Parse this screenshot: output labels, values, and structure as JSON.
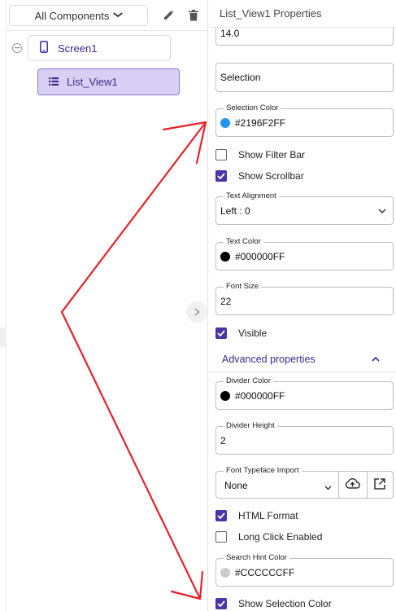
{
  "left_panel": {
    "component_filter": "All Components",
    "tree": {
      "screen": "Screen1",
      "list_view": "List_View1"
    }
  },
  "properties": {
    "title": "List_View1 Properties",
    "font_size_top_value": "14.0",
    "selection_value": "Selection",
    "selection_color": {
      "label": "Selection Color",
      "value": "#2196F2FF",
      "swatch": "#2196F2"
    },
    "show_filter_bar": {
      "label": "Show Filter Bar",
      "checked": false
    },
    "show_scrollbar": {
      "label": "Show Scrollbar",
      "checked": true
    },
    "text_alignment": {
      "label": "Text Alignment",
      "value": "Left : 0"
    },
    "text_color": {
      "label": "Text Color",
      "value": "#000000FF",
      "swatch": "#000000"
    },
    "font_size": {
      "label": "Font Size",
      "value": "22"
    },
    "visible": {
      "label": "Visible",
      "checked": true
    },
    "advanced_label": "Advanced properties",
    "divider_color": {
      "label": "Divider Color",
      "value": "#000000FF",
      "swatch": "#000000"
    },
    "divider_height": {
      "label": "Divider Height",
      "value": "2"
    },
    "font_typeface_import": {
      "label": "Font Typeface Import",
      "value": "None"
    },
    "html_format": {
      "label": "HTML Format",
      "checked": true
    },
    "long_click_enabled": {
      "label": "Long Click Enabled",
      "checked": false
    },
    "search_hint_color": {
      "label": "Search Hint Color",
      "value": "#CCCCCCFF",
      "swatch": "#CCCCCC"
    },
    "show_selection_color": {
      "label": "Show Selection Color",
      "checked": true
    }
  },
  "colors": {
    "accent": "#4A35A8",
    "selected_node_bg": "#D7D0F4",
    "annotation_arrow": "#E8202A"
  }
}
